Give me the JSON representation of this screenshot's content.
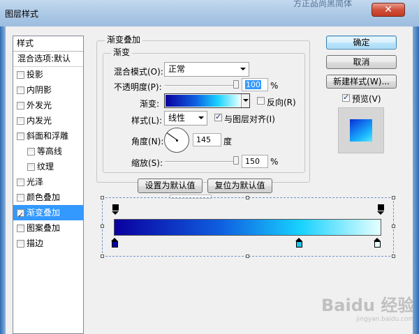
{
  "window": {
    "title": "图层样式",
    "background_title": "方正品尚黑简体",
    "close_glyph": "✕"
  },
  "styles_list": {
    "header": "样式",
    "items": [
      {
        "label": "混合选项:默认",
        "checkbox": false,
        "checked": false,
        "sub": false,
        "selected": false
      },
      {
        "label": "投影",
        "checkbox": true,
        "checked": false,
        "sub": false,
        "selected": false
      },
      {
        "label": "内阴影",
        "checkbox": true,
        "checked": false,
        "sub": false,
        "selected": false
      },
      {
        "label": "外发光",
        "checkbox": true,
        "checked": false,
        "sub": false,
        "selected": false
      },
      {
        "label": "内发光",
        "checkbox": true,
        "checked": false,
        "sub": false,
        "selected": false
      },
      {
        "label": "斜面和浮雕",
        "checkbox": true,
        "checked": false,
        "sub": false,
        "selected": false
      },
      {
        "label": "等高线",
        "checkbox": true,
        "checked": false,
        "sub": true,
        "selected": false
      },
      {
        "label": "纹理",
        "checkbox": true,
        "checked": false,
        "sub": true,
        "selected": false
      },
      {
        "label": "光泽",
        "checkbox": true,
        "checked": false,
        "sub": false,
        "selected": false
      },
      {
        "label": "颜色叠加",
        "checkbox": true,
        "checked": false,
        "sub": false,
        "selected": false
      },
      {
        "label": "渐变叠加",
        "checkbox": true,
        "checked": true,
        "sub": false,
        "selected": true
      },
      {
        "label": "图案叠加",
        "checkbox": true,
        "checked": false,
        "sub": false,
        "selected": false
      },
      {
        "label": "描边",
        "checkbox": true,
        "checked": false,
        "sub": false,
        "selected": false
      }
    ]
  },
  "gradient_overlay": {
    "group_title": "渐变叠加",
    "sub_group_title": "渐变",
    "blend_mode_label": "混合模式(O):",
    "blend_mode_value": "正常",
    "opacity_label": "不透明度(P):",
    "opacity_value": "100",
    "opacity_unit": "%",
    "opacity_level": 1.0,
    "gradient_label": "渐变:",
    "reverse_label": "反向(R)",
    "reverse_checked": false,
    "style_label": "样式(L):",
    "style_value": "线性",
    "align_label": "与图层对齐(I)",
    "align_checked": true,
    "angle_label": "角度(N):",
    "angle_value": "145",
    "angle_unit": "度",
    "angle_degrees": 145,
    "scale_label": "缩放(S):",
    "scale_value": "150",
    "scale_unit": "%",
    "scale_level": 1.0,
    "make_default_label": "设置为默认值",
    "reset_default_label": "复位为默认值"
  },
  "gradient_editor": {
    "colors": [
      "#0a00a0",
      "#0f5fe0",
      "#18d2ff",
      "#e6ffff"
    ],
    "color_stops": [
      {
        "location": 0,
        "color": "#0a00a0"
      },
      {
        "location": 0.69,
        "color": "#18c7ee"
      },
      {
        "location": 1.0,
        "color": "#e6ffff"
      }
    ],
    "opacity_stops": [
      {
        "location": 0
      },
      {
        "location": 1.0
      }
    ]
  },
  "buttons": {
    "ok": "确定",
    "cancel": "取消",
    "new_style": "新建样式(W)...",
    "preview_label": "预览(V)",
    "preview_checked": true
  },
  "watermark": {
    "text": "Baidu 经验",
    "sub": "jingyan.baidu.com"
  }
}
